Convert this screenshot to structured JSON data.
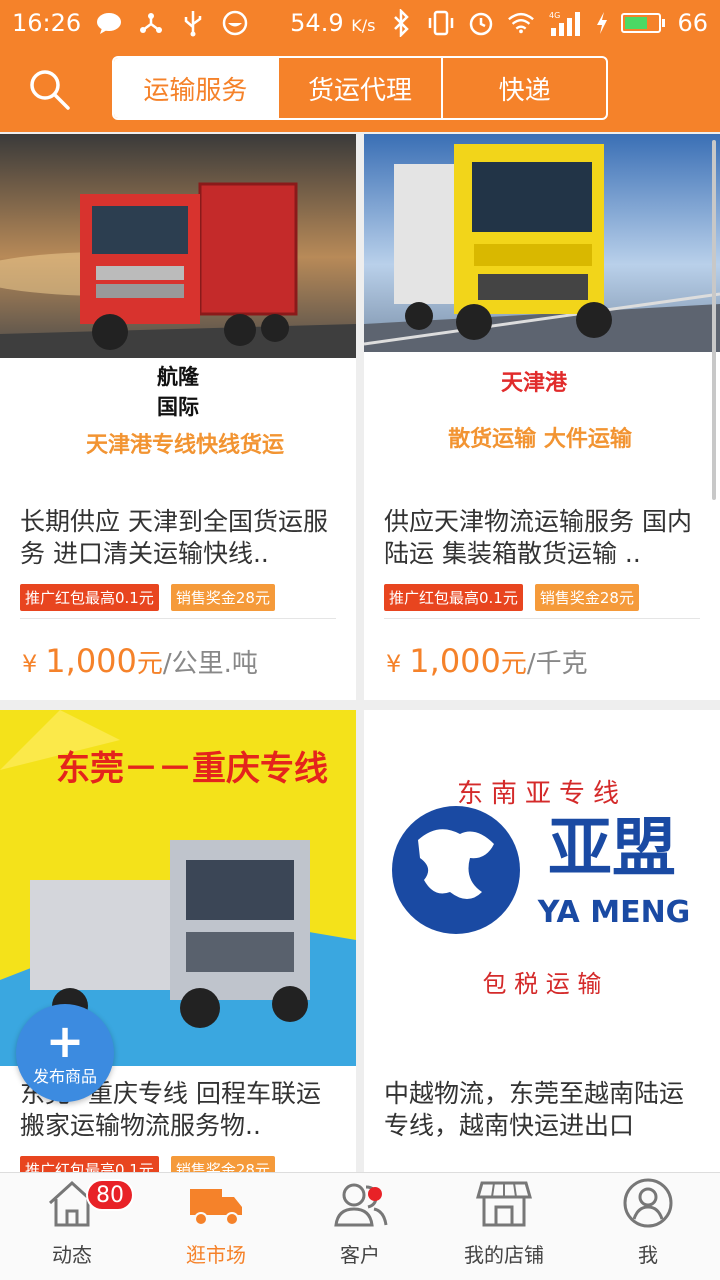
{
  "status_bar": {
    "time": "16:26",
    "speed": "54.9",
    "speed_unit": "K/s",
    "battery": "66",
    "network": "4G",
    "battery_level": 0.66
  },
  "header": {
    "tabs": [
      {
        "label": "运输服务",
        "active": true
      },
      {
        "label": "货运代理",
        "active": false
      },
      {
        "label": "快递",
        "active": false
      }
    ]
  },
  "cards": [
    {
      "image_text_lines": [
        "航隆",
        "国际"
      ],
      "image_slogan": "天津港专线快线货运",
      "title": "长期供应 天津到全国货运服务 进口清关运输快线..",
      "tag_red": "推广红包最高0.1元",
      "tag_orange": "销售奖金28元",
      "price_symbol": "¥",
      "price_value": "1,000",
      "price_unit": "元",
      "price_per": "/公里.吨"
    },
    {
      "image_text_lines": [
        "天津港"
      ],
      "image_slogan": "散货运输 大件运输",
      "title": "供应天津物流运输服务 国内陆运 集装箱散货运输 ..",
      "tag_red": "推广红包最高0.1元",
      "tag_orange": "销售奖金28元",
      "price_symbol": "¥",
      "price_value": "1,000",
      "price_unit": "元",
      "price_per": "/千克"
    },
    {
      "image_banner": "东莞－－重庆专线",
      "title": "东莞--重庆专线 回程车联运搬家运输物流服务物..",
      "tag_red": "推广红包最高0.1元",
      "tag_orange": "销售奖金28元"
    },
    {
      "image_top": "东南亚专线",
      "image_logo_cn": "亚盟",
      "image_logo_en": "YA MENG",
      "image_bottom": "包 税 运 输",
      "title": "中越物流，东莞至越南陆运专线，越南快运进出口"
    }
  ],
  "fab": {
    "label": "发布商品"
  },
  "bottom_nav": [
    {
      "label": "动态",
      "badge": "80",
      "icon": "home-icon"
    },
    {
      "label": "逛市场",
      "active": true,
      "icon": "truck-icon"
    },
    {
      "label": "客户",
      "dot": true,
      "icon": "customers-icon"
    },
    {
      "label": "我的店铺",
      "icon": "store-icon"
    },
    {
      "label": "我",
      "icon": "profile-icon"
    }
  ],
  "colors": {
    "accent": "#f5822a",
    "badge": "#e82227",
    "fab": "#3c8be0"
  }
}
